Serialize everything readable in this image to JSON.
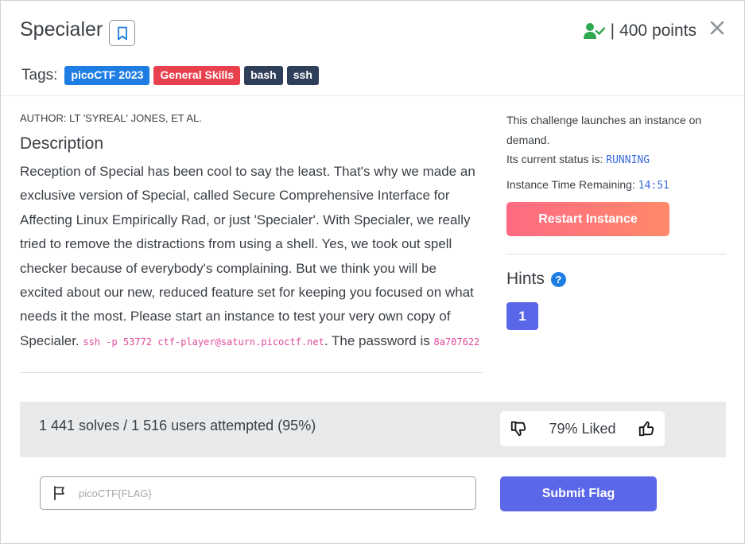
{
  "challenge": {
    "title": "Specialer",
    "points_separator": "|",
    "points": "400 points"
  },
  "tags": {
    "label": "Tags:",
    "items": [
      "picoCTF 2023",
      "General Skills",
      "bash",
      "ssh"
    ]
  },
  "description": {
    "author": "AUTHOR: LT 'SYREAL' JONES, ET AL.",
    "heading": "Description",
    "body": "Reception of Special has been cool to say the least. That's why we made an exclusive version of Special, called Secure Comprehensive Interface for Affecting Linux Empirically Rad, or just 'Specialer'. With Specialer, we really tried to remove the distractions from using a shell. Yes, we took out spell checker because of everybody's complaining. But we think you will be excited about our new, reduced feature set for keeping you focused on what needs it the most. Please start an instance to test your very own copy of Specialer.",
    "ssh_command": "ssh -p 53772 ctf-player@saturn.picoctf.net",
    "password_text": ". The password is ",
    "password": "8a707622"
  },
  "instance": {
    "launch_text": "This challenge launches an instance on demand.",
    "status_label": "Its current status is: ",
    "status": "RUNNING",
    "time_label": "Instance Time Remaining: ",
    "time_remaining": "14:51",
    "restart_label": "Restart Instance"
  },
  "hints": {
    "heading": "Hints",
    "help_glyph": "?",
    "items": [
      "1"
    ]
  },
  "stats": {
    "solves": "1 441 solves / 1 516 users attempted (95%)",
    "liked": "79% Liked"
  },
  "flag_form": {
    "placeholder": "picoCTF{FLAG}",
    "submit_label": "Submit Flag"
  },
  "colors": {
    "primary": "#5a67e8",
    "tag_blue": "#1e7de2",
    "tag_red": "#e8404c",
    "tag_dark": "#2f3e59",
    "solved_green": "#2fa84f",
    "status_blue": "#3b6be0",
    "code_pink": "#e0489a"
  }
}
